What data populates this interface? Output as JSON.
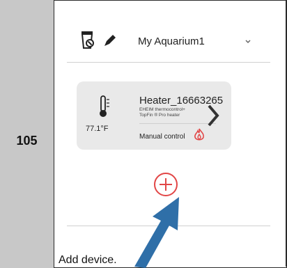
{
  "step": {
    "number": "105"
  },
  "toolbar": {
    "aquarium_name": "My Aquarium1",
    "icons": [
      "trash-icon",
      "pencil-icon",
      "chevron-down-icon"
    ]
  },
  "device_card": {
    "temperature": "77.1°F",
    "name": "Heater_16663265",
    "description_line1": "EHEIM thermocontrol+",
    "description_line2": "TopFin ® Pro heater",
    "control_mode": "Manual control",
    "icons": [
      "thermometer-icon",
      "flame-icon",
      "chevron-right-icon"
    ]
  },
  "add_button": {
    "icon": "plus-circle-icon"
  },
  "caption": "Add device.",
  "colors": {
    "step_column_bg": "#c8c8c8",
    "card_bg": "#e9e9e9",
    "accent_red": "#e24646",
    "arrow_blue": "#2f6fa8"
  }
}
